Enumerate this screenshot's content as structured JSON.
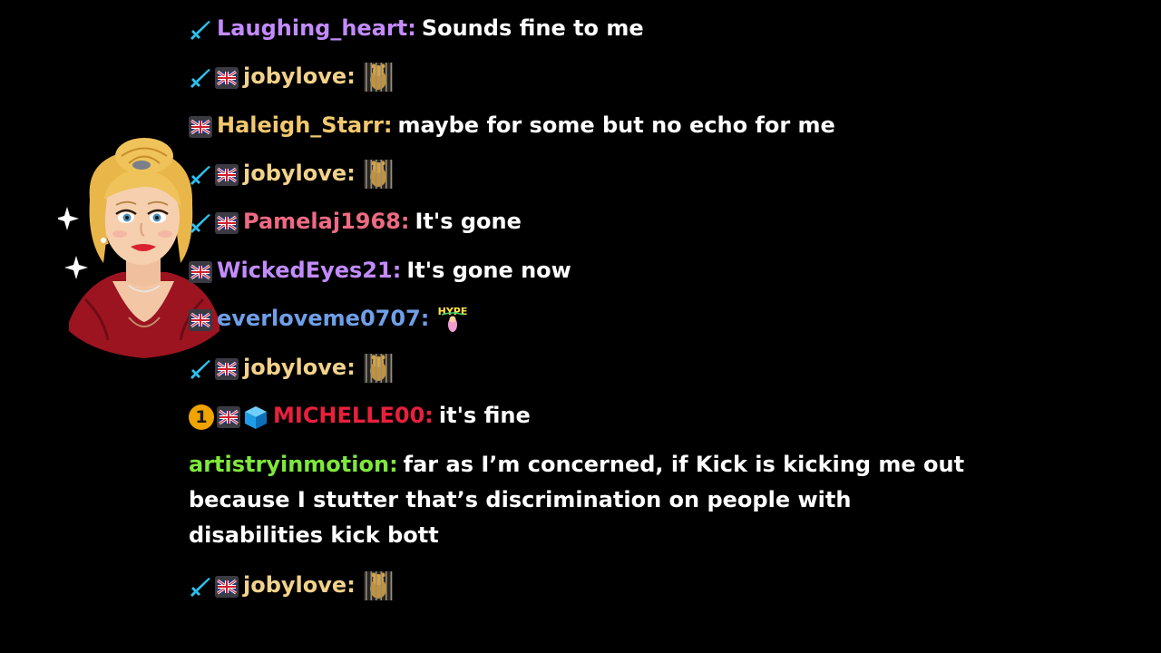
{
  "colors": {
    "background": "#000000",
    "message_text": "#ffffff",
    "sword_badge": "#2ec2f0",
    "rank_badge": "#f0a400",
    "cube_badge": "#1e9de6"
  },
  "messages": [
    {
      "username": "Laughing_heart",
      "color": "#c38bff",
      "badges": [
        "sword-badge-icon"
      ],
      "text": "Sounds fine to me"
    },
    {
      "username": "jobylove",
      "color": "#f2d28a",
      "badges": [
        "sword-badge-icon",
        "uk-flag-icon"
      ],
      "emote": "caged-bear-emote-icon"
    },
    {
      "username": "Haleigh_Starr",
      "color": "#f2c86e",
      "badges": [
        "uk-flag-icon"
      ],
      "text": "maybe for some but no echo for me"
    },
    {
      "username": "jobylove",
      "color": "#f2d28a",
      "badges": [
        "sword-badge-icon",
        "uk-flag-icon"
      ],
      "emote": "caged-bear-emote-icon"
    },
    {
      "username": "Pamelaj1968",
      "color": "#ee6a82",
      "badges": [
        "sword-badge-icon",
        "uk-flag-icon"
      ],
      "text": "It's gone"
    },
    {
      "username": "WickedEyes21",
      "color": "#c38bff",
      "badges": [
        "uk-flag-icon"
      ],
      "text": "It's gone now"
    },
    {
      "username": "everloveme0707",
      "color": "#6f9fe8",
      "badges": [
        "uk-flag-icon"
      ],
      "emote": "hype-emote-icon"
    },
    {
      "username": "jobylove",
      "color": "#f2d28a",
      "badges": [
        "sword-badge-icon",
        "uk-flag-icon"
      ],
      "emote": "caged-bear-emote-icon"
    },
    {
      "username": "MICHELLE00",
      "color": "#e8203c",
      "badges": [
        "rank-1-badge-icon",
        "uk-flag-icon",
        "cube-badge-icon"
      ],
      "rank_label": "1",
      "text": "it's fine"
    },
    {
      "username": "artistryinmotion",
      "color": "#7ee83b",
      "badges": [],
      "text": "far as I’m concerned, if Kick is kicking me out because I stutter that’s discrimination on people with disabilities kick bott"
    },
    {
      "username": "jobylove",
      "color": "#f2d28a",
      "badges": [
        "sword-badge-icon",
        "uk-flag-icon"
      ],
      "emote": "caged-bear-emote-icon"
    }
  ],
  "emotes": {
    "hype_label": "HYPE"
  },
  "colon": ":",
  "avatar": {
    "name": "streamer-avatar-illustration"
  }
}
